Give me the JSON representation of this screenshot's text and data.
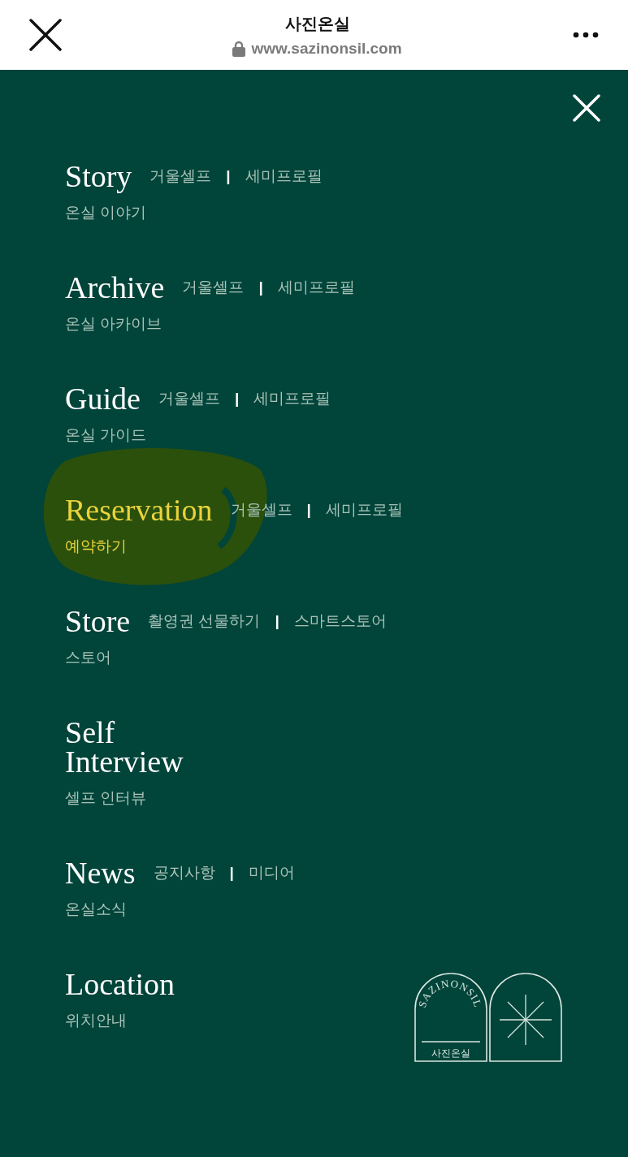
{
  "browser_bar": {
    "title": "사진온실",
    "url": "www.sazinonsil.com"
  },
  "menu": [
    {
      "title": "Story",
      "subtitle": "온실 이야기",
      "selected": false,
      "highlighted": false,
      "links": [
        {
          "kind": "link",
          "text": "거울셀프"
        },
        {
          "kind": "separator",
          "text": "|"
        },
        {
          "kind": "link",
          "text": "세미프로필"
        }
      ]
    },
    {
      "title": "Archive",
      "subtitle": "온실 아카이브",
      "selected": false,
      "highlighted": false,
      "links": [
        {
          "kind": "link",
          "text": "거울셀프"
        },
        {
          "kind": "separator",
          "text": "|"
        },
        {
          "kind": "link",
          "text": "세미프로필"
        }
      ]
    },
    {
      "title": "Guide",
      "subtitle": "온실 가이드",
      "selected": false,
      "highlighted": false,
      "links": [
        {
          "kind": "link",
          "text": "거울셀프"
        },
        {
          "kind": "separator",
          "text": "|"
        },
        {
          "kind": "link",
          "text": "세미프로필"
        }
      ]
    },
    {
      "title": "Reservation",
      "subtitle": "예약하기",
      "selected": true,
      "highlighted": true,
      "links": [
        {
          "kind": "link",
          "text": "거울셀프"
        },
        {
          "kind": "separator",
          "text": "|"
        },
        {
          "kind": "link",
          "text": "세미프로필"
        }
      ]
    },
    {
      "title": "Store",
      "subtitle": "스토어",
      "selected": false,
      "highlighted": false,
      "links": [
        {
          "kind": "link",
          "text": "촬영권 선물하기"
        },
        {
          "kind": "separator",
          "text": "|"
        },
        {
          "kind": "link",
          "text": "스마트스토어"
        }
      ]
    },
    {
      "title": "Self Interview",
      "subtitle": "셀프 인터뷰",
      "selected": false,
      "highlighted": false
    },
    {
      "title": "News",
      "subtitle": "온실소식",
      "selected": false,
      "highlighted": false,
      "links": [
        {
          "kind": "link",
          "text": "공지사항"
        },
        {
          "kind": "separator",
          "text": "|"
        },
        {
          "kind": "link",
          "text": "미디어"
        }
      ]
    },
    {
      "title": "Location",
      "subtitle": "위치안내",
      "selected": false,
      "highlighted": false
    }
  ],
  "logo": {
    "arc_text": "SAZINONSIL",
    "caption": "사진온실"
  }
}
